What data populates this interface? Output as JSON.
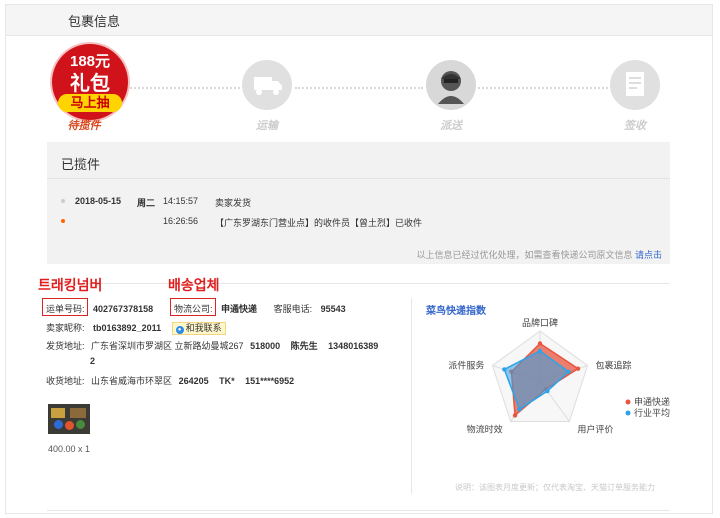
{
  "header": {
    "title": "包裹信息"
  },
  "promo": {
    "amount": "188元",
    "gift": "礼包",
    "button": "马上抽"
  },
  "steps": [
    {
      "label": "待揽件",
      "active": true,
      "icon": "gift-promo-icon"
    },
    {
      "label": "运输",
      "active": false,
      "icon": "truck-icon"
    },
    {
      "label": "派送",
      "active": false,
      "icon": "courier-icon"
    },
    {
      "label": "签收",
      "active": false,
      "icon": "receipt-icon"
    }
  ],
  "tracking": {
    "status_title": "已揽件",
    "events": [
      {
        "date": "2018-05-15",
        "weekday": "周二",
        "time": "14:15:57",
        "desc": "卖家发货"
      },
      {
        "date": "",
        "weekday": "",
        "time": "16:26:56",
        "desc": "【广东罗湖东门营业点】的收件员【曾土烈】已收件"
      }
    ],
    "note": "以上信息已经过优化处理，如需查看快递公司原文信息",
    "note_link": "请点击"
  },
  "annotations": {
    "tracking_number": "트래킹넘버",
    "courier": "배송업체"
  },
  "order": {
    "tracking_label": "运单号码:",
    "tracking_number": "402767378158",
    "courier_label": "物流公司:",
    "courier": "申通快递",
    "hotline_label": "客服电话:",
    "hotline": "95543",
    "seller_label": "卖家昵称:",
    "seller": "tb0163892_2011",
    "contact_label": "和我联系",
    "ship_label": "发货地址:",
    "ship_address": "广东省深圳市罗湖区 立新路幼曼城267",
    "ship_postcode": "518000",
    "ship_name": "陈先生",
    "ship_phone": "1348016389",
    "ship_phone_tail": "2",
    "recv_label": "收货地址:",
    "recv_address": "山东省威海市环翠区",
    "recv_postcode": "264205",
    "recv_name": "TK*",
    "recv_phone": "151****6952"
  },
  "product": {
    "price_qty": "400.00 x 1"
  },
  "radar": {
    "title": "菜鸟快递指数",
    "axes": [
      "品牌口碑",
      "包裹追踪",
      "用户评价",
      "物流时效",
      "派件服务"
    ],
    "series": [
      {
        "name": "申通快递",
        "color": "#e8563f",
        "values": [
          0.75,
          0.8,
          0.2,
          0.85,
          0.6
        ]
      },
      {
        "name": "行业平均",
        "color": "#2ea3e8",
        "values": [
          0.6,
          0.6,
          0.25,
          0.7,
          0.75
        ]
      }
    ],
    "footnote": "说明：该图表月度更新；仅代表淘宝、天猫订单服务能力"
  }
}
